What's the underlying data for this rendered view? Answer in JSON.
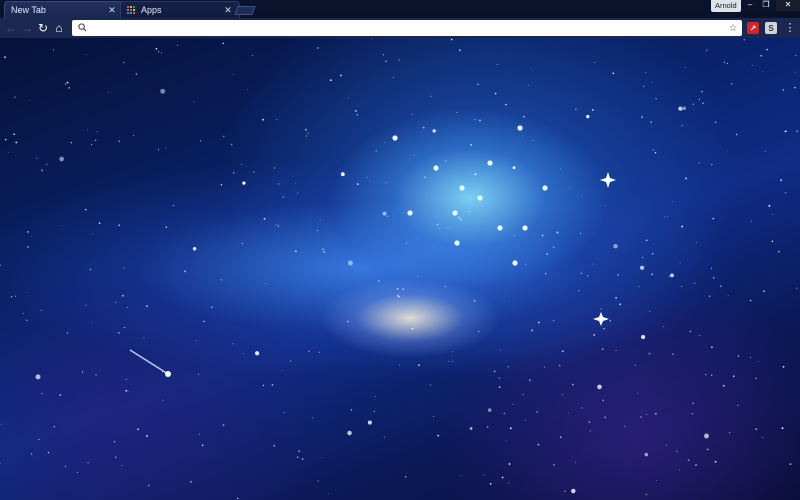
{
  "window": {
    "profile_name": "Arnold",
    "controls": {
      "minimize": "–",
      "maximize": "❐",
      "close": "✕"
    }
  },
  "tabs": [
    {
      "label": "New Tab",
      "active": true,
      "close": "✕"
    },
    {
      "label": "Apps",
      "active": false,
      "close": "✕",
      "icon": "apps-grid-icon"
    }
  ],
  "toolbar": {
    "back": "←",
    "forward": "→",
    "reload": "↻",
    "home": "⌂",
    "omnibox": {
      "value": "",
      "placeholder": ""
    },
    "star": "☆",
    "extensions": [
      {
        "name": "red-arrow-extension-icon",
        "glyph": "↗",
        "color": "#d0262a"
      },
      {
        "name": "s-extension-icon",
        "glyph": "S",
        "color": "#cfd3da"
      }
    ],
    "menu": "⋮"
  },
  "content": {
    "background": "space-galaxy-wallpaper"
  },
  "colors": {
    "tab_active": "#20305c",
    "toolbar": "#1a2750",
    "wallpaper_blue": "#1a4fc0"
  }
}
